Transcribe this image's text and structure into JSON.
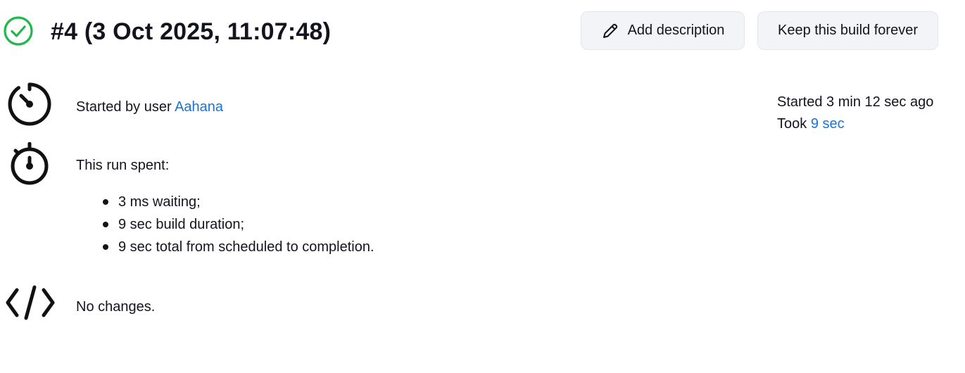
{
  "header": {
    "build_title": "#4 (3 Oct 2025, 11:07:48)",
    "status": "success"
  },
  "actions": {
    "add_description_label": "Add description",
    "keep_forever_label": "Keep this build forever"
  },
  "cause": {
    "prefix": "Started by user",
    "user": "Aahana"
  },
  "timing": {
    "started": "Started 3 min 12 sec ago",
    "took_prefix": "Took",
    "took_value": "9 sec"
  },
  "spent": {
    "heading": "This run spent:",
    "items": [
      "3 ms waiting;",
      "9 sec build duration;",
      "9 sec total from scheduled to completion."
    ]
  },
  "changes": {
    "text": "No changes."
  },
  "colors": {
    "success": "#1fb84c",
    "link": "#1a73d9",
    "button_bg": "#f2f4f7"
  },
  "icons": [
    "check-circle-icon",
    "pencil-icon",
    "speedometer-icon",
    "stopwatch-icon",
    "code-icon"
  ]
}
